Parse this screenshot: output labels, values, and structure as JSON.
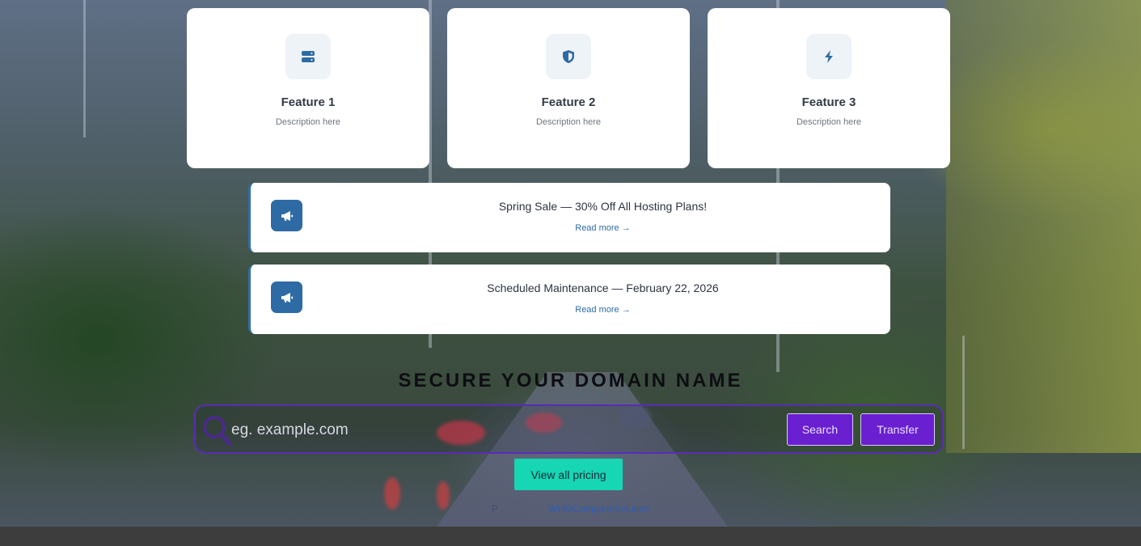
{
  "features": [
    {
      "title": "Feature 1",
      "description": "Description here",
      "icon": "server-icon"
    },
    {
      "title": "Feature 2",
      "description": "Description here",
      "icon": "shield-icon"
    },
    {
      "title": "Feature 3",
      "description": "Description here",
      "icon": "bolt-icon"
    }
  ],
  "announcements": [
    {
      "title": "Spring Sale — 30% Off All Hosting Plans!",
      "link_label": "Read more →",
      "icon": "megaphone-icon"
    },
    {
      "title": "Scheduled Maintenance — February 22, 2026",
      "link_label": "Read more →",
      "icon": "megaphone-icon"
    }
  ],
  "domain_search": {
    "heading": "SECURE YOUR DOMAIN NAME",
    "placeholder": "eg. example.com",
    "search_label": "Search",
    "transfer_label": "Transfer",
    "icon": "search-icon"
  },
  "pricing_button_label": "View all pricing",
  "powered_by": {
    "prefix": "P",
    "link": "WHMCompleteSolution"
  },
  "colors": {
    "accent_blue": "#2e6ba5",
    "purple": "#6a1fd0",
    "teal": "#16d6b3"
  }
}
